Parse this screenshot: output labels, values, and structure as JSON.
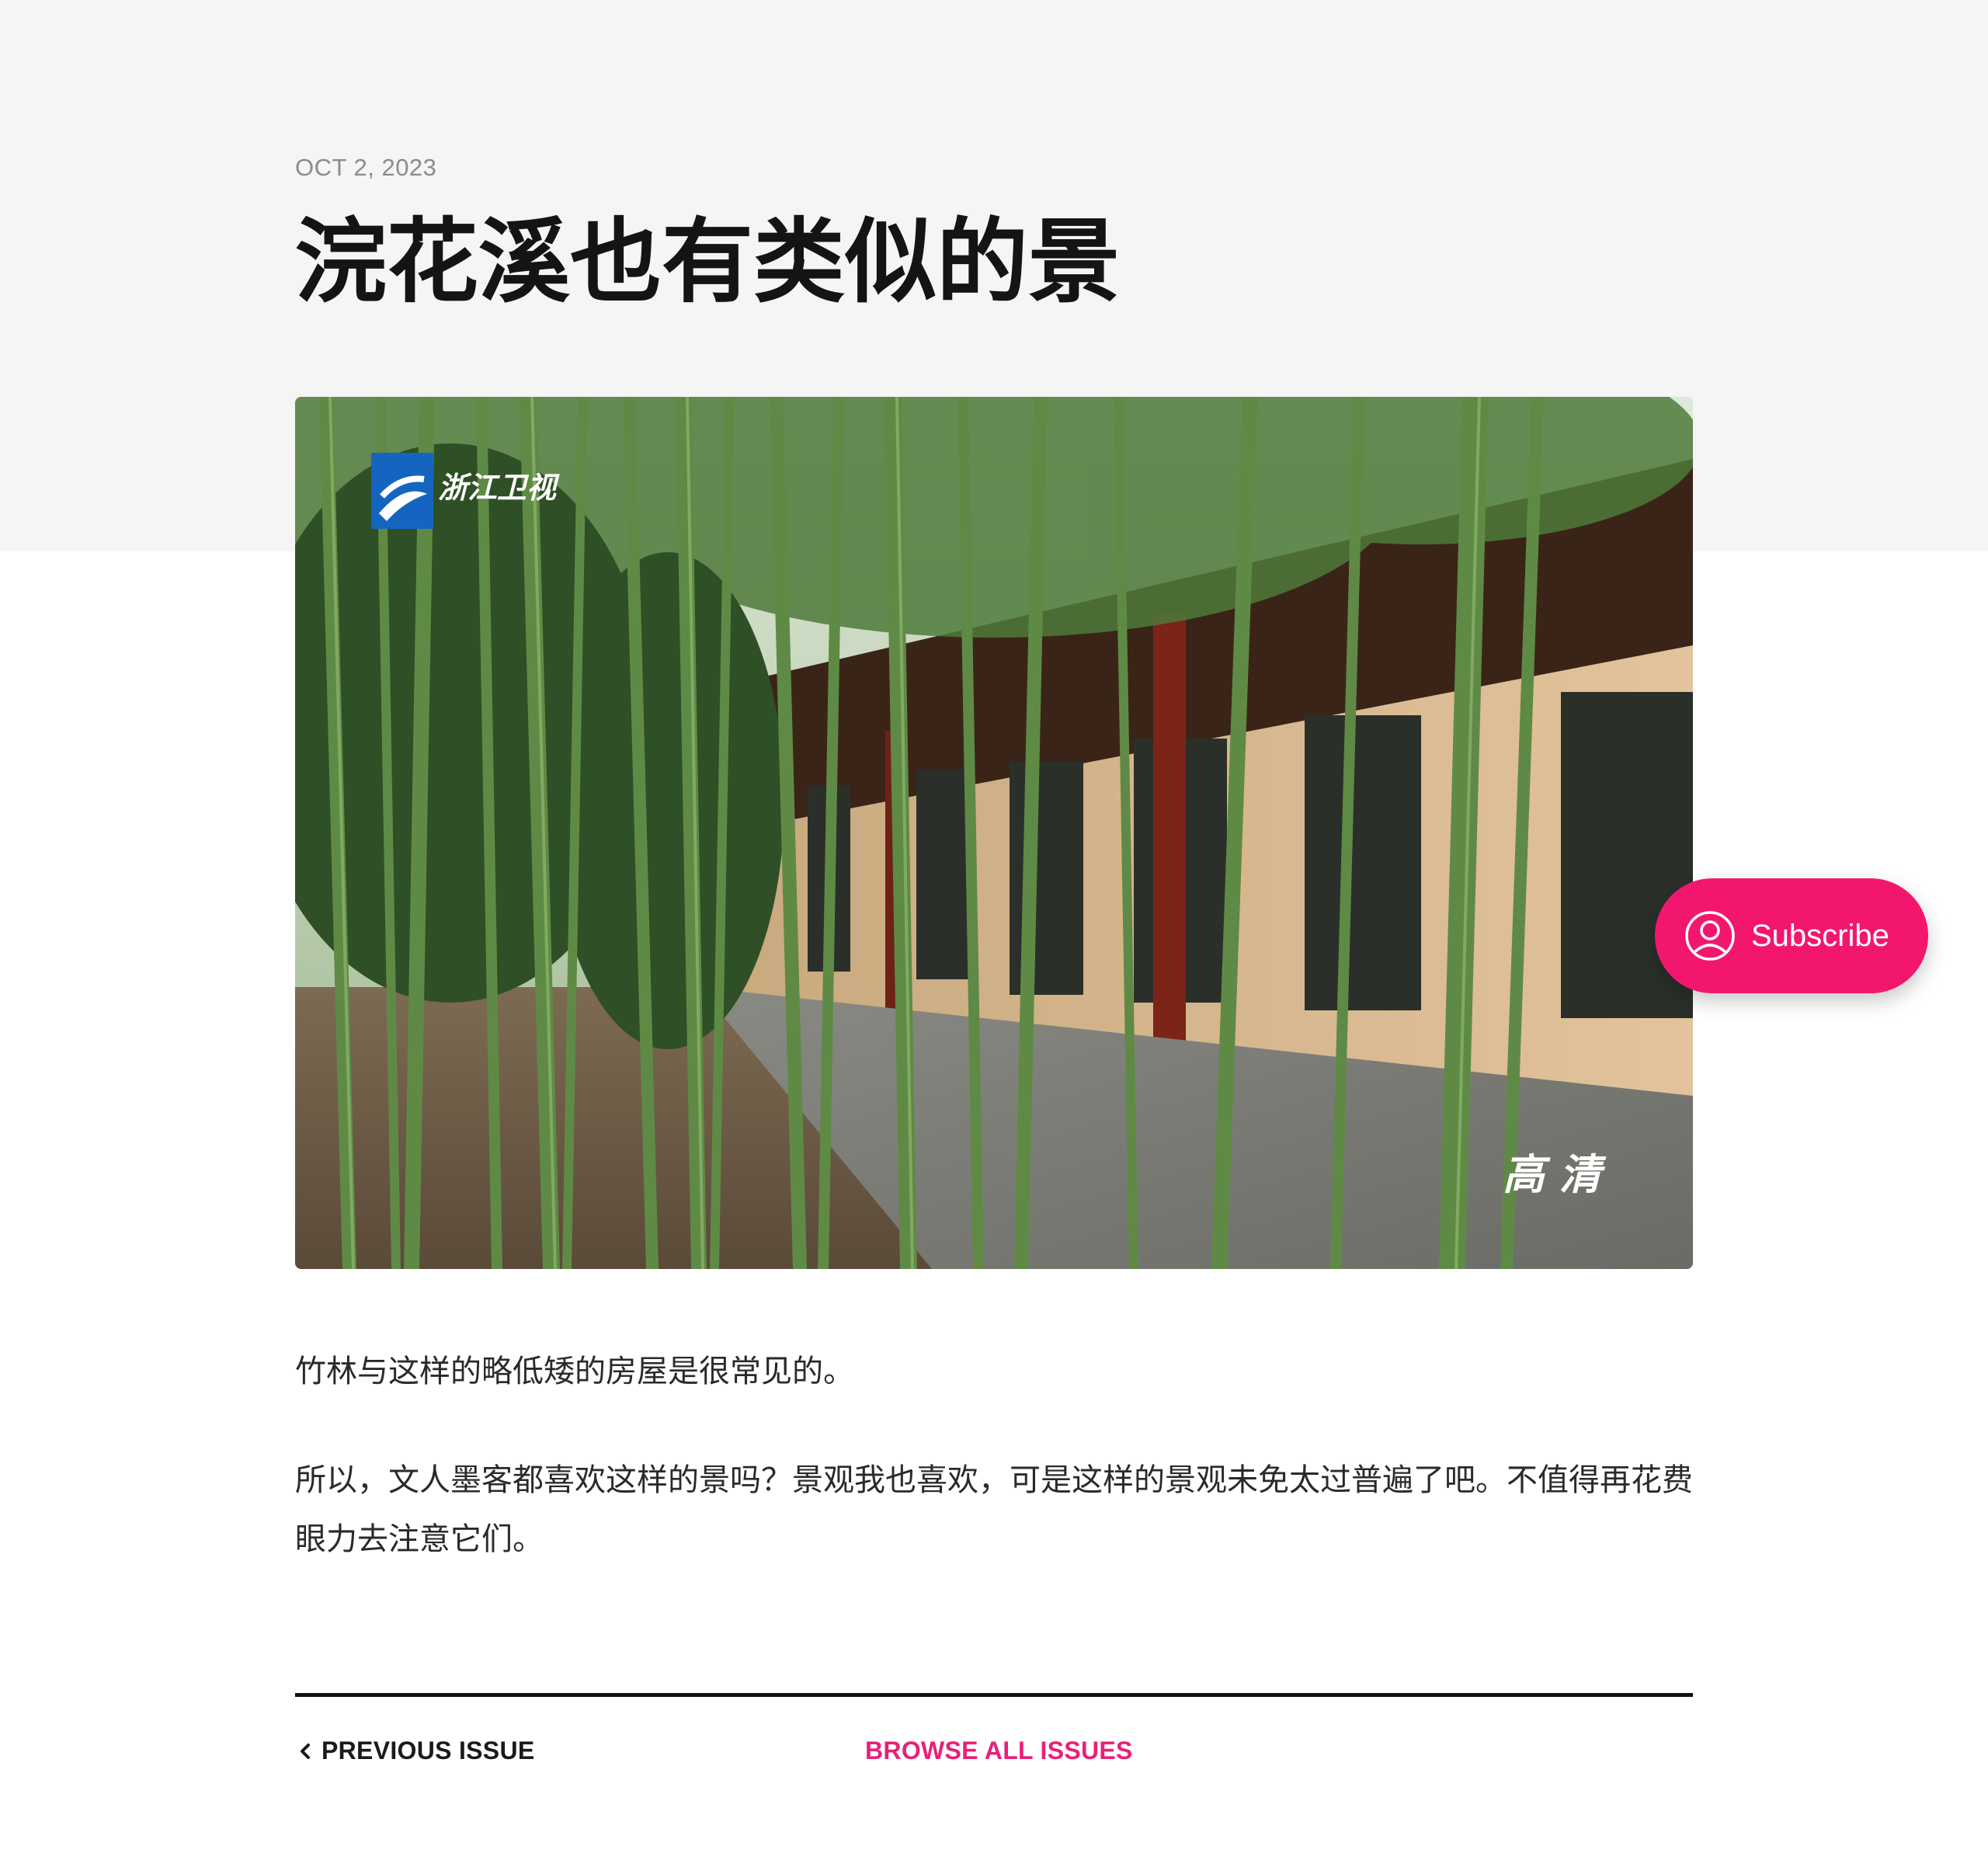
{
  "post": {
    "date": "OCT 2, 2023",
    "title": "浣花溪也有类似的景",
    "hero_image": {
      "description": "bamboo grove in front of low traditional houses with red pillars",
      "overlay_logo_text": "浙江卫视",
      "overlay_corner_text": "高 清"
    },
    "paragraphs": [
      "竹林与这样的略低矮的房屋是很常见的。",
      "所以，文人墨客都喜欢这样的景吗？景观我也喜欢，可是这样的景观未免太过普遍了吧。不值得再花费眼力去注意它们。"
    ]
  },
  "issue_nav": {
    "previous_label": "PREVIOUS ISSUE",
    "browse_all_label": "BROWSE ALL ISSUES"
  },
  "subscribe": {
    "label": "Subscribe",
    "icon": "user-circle-icon"
  },
  "colors": {
    "accent": "#f3166f",
    "link_accent": "#e8207a",
    "hero_band": "#f5f5f5",
    "date_text": "#8b8b8b",
    "title_text": "#141414"
  }
}
